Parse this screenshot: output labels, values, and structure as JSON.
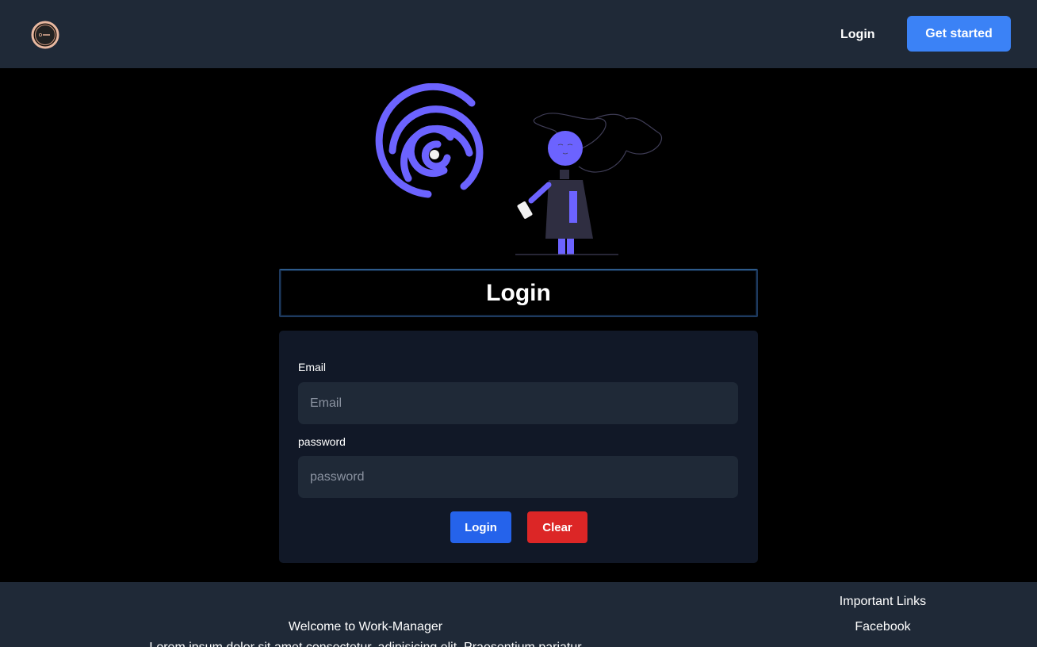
{
  "nav": {
    "logo_icon": "circle-logo-icon",
    "login_label": "Login",
    "get_started_label": "Get started"
  },
  "illustration": {
    "icon": "fingerprint-person-illustration"
  },
  "heading": {
    "title": "Login"
  },
  "form": {
    "email_label": "Email",
    "email_placeholder": "Email",
    "email_value": "",
    "password_label": "password",
    "password_placeholder": "password",
    "password_value": "",
    "login_button": "Login",
    "clear_button": "Clear"
  },
  "footer": {
    "welcome": "Welcome to Work-Manager",
    "lorem": "Lorem ipsum dolor sit amet consectetur, adipisicing elit. Praesentium pariatur",
    "links_title": "Important Links",
    "links": [
      "Facebook"
    ]
  },
  "colors": {
    "nav_bg": "#1f2937",
    "primary": "#3b82f6",
    "login_button": "#2563eb",
    "clear_button": "#dc2626",
    "card_bg": "#111827",
    "input_bg": "#1f2937",
    "illustration_accent": "#6c63ff"
  }
}
